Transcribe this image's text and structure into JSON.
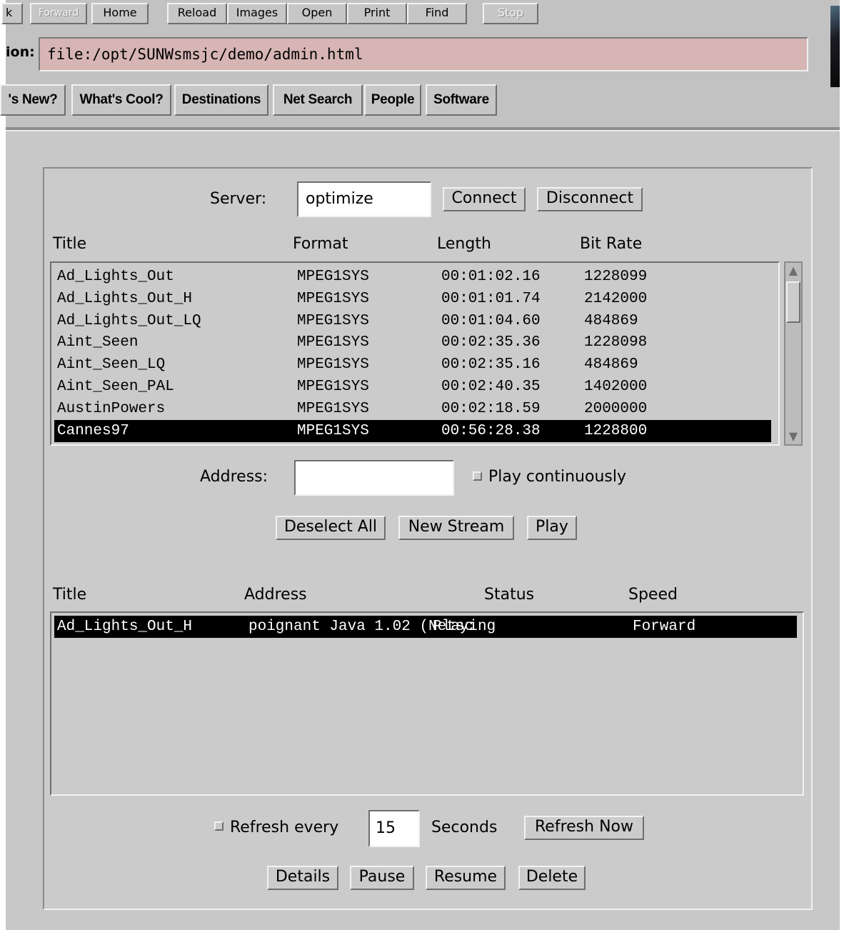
{
  "toolbar": {
    "partial_back": "k",
    "forward": "Forward",
    "home": "Home",
    "reload": "Reload",
    "images": "Images",
    "open": "Open",
    "print": "Print",
    "find": "Find",
    "stop": "Stop"
  },
  "location": {
    "label": "ion:",
    "url": "file:/opt/SUNWsmsjc/demo/admin.html"
  },
  "directory": {
    "whats_new": "'s New?",
    "whats_cool": "What's Cool?",
    "destinations": "Destinations",
    "net_search": "Net Search",
    "people": "People",
    "software": "Software"
  },
  "server": {
    "label": "Server:",
    "value": "optimize",
    "connect": "Connect",
    "disconnect": "Disconnect"
  },
  "titles_table": {
    "headers": [
      "Title",
      "Format",
      "Length",
      "Bit Rate"
    ],
    "rows": [
      {
        "title": "Ad_Lights_Out",
        "format": "MPEG1SYS",
        "length": "00:01:02.16",
        "bitrate": "1228099"
      },
      {
        "title": "Ad_Lights_Out_H",
        "format": "MPEG1SYS",
        "length": "00:01:01.74",
        "bitrate": "2142000"
      },
      {
        "title": "Ad_Lights_Out_LQ",
        "format": "MPEG1SYS",
        "length": "00:01:04.60",
        "bitrate": "484869"
      },
      {
        "title": "Aint_Seen",
        "format": "MPEG1SYS",
        "length": "00:02:35.36",
        "bitrate": "1228098"
      },
      {
        "title": "Aint_Seen_LQ",
        "format": "MPEG1SYS",
        "length": "00:02:35.16",
        "bitrate": "484869"
      },
      {
        "title": "Aint_Seen_PAL",
        "format": "MPEG1SYS",
        "length": "00:02:40.35",
        "bitrate": "1402000"
      },
      {
        "title": "AustinPowers",
        "format": "MPEG1SYS",
        "length": "00:02:18.59",
        "bitrate": "2000000"
      },
      {
        "title": "Cannes97",
        "format": "MPEG1SYS",
        "length": "00:56:28.38",
        "bitrate": "1228800"
      }
    ],
    "selected_index": 7
  },
  "address": {
    "label": "Address:",
    "value": "",
    "play_continuously": "Play continuously"
  },
  "stream_buttons": {
    "deselect_all": "Deselect All",
    "new_stream": "New Stream",
    "play": "Play"
  },
  "streams_table": {
    "headers": [
      "Title",
      "Address",
      "Status",
      "Speed"
    ],
    "rows": [
      {
        "title": "Ad_Lights_Out_H",
        "address": "poignant Java 1.02 (Netsc",
        "status": "Playing",
        "speed": "Forward"
      }
    ]
  },
  "refresh": {
    "label": "Refresh every",
    "value": "15",
    "unit": "Seconds",
    "refresh_now": "Refresh Now"
  },
  "actions": {
    "details": "Details",
    "pause": "Pause",
    "resume": "Resume",
    "delete": "Delete"
  },
  "colors": {
    "location_field": "#d7b5b5",
    "panel_gray": "#cbcbcb",
    "selection": "#000000"
  }
}
